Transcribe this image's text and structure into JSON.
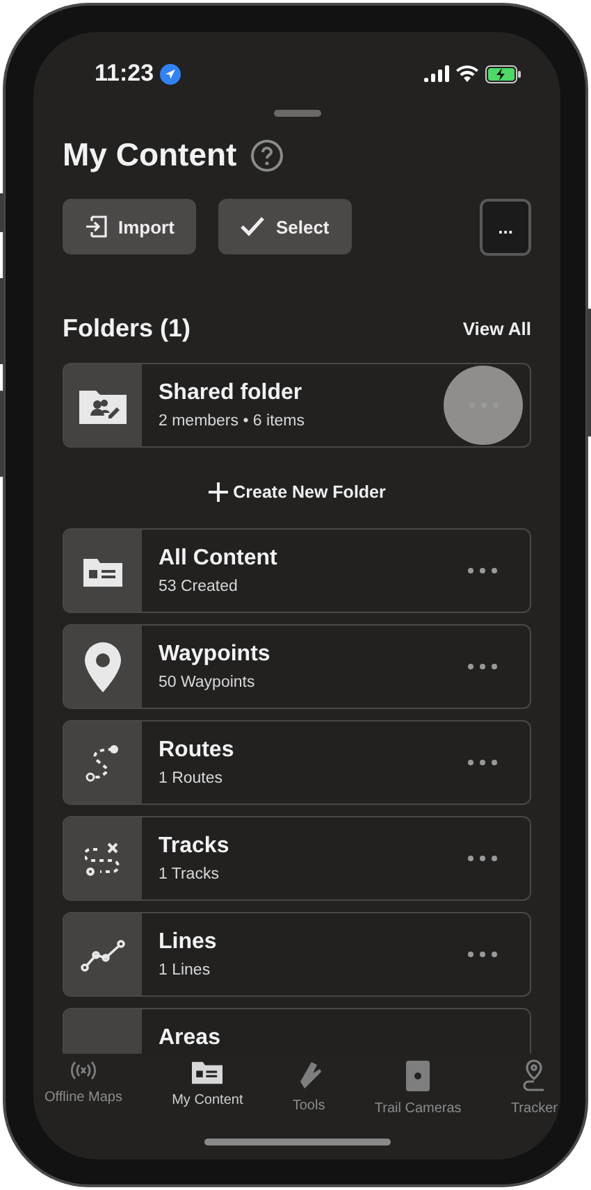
{
  "status_bar": {
    "time": "11:23",
    "location_active": true
  },
  "title": "My Content",
  "actions": [
    {
      "kind": "import",
      "label": "Import"
    },
    {
      "kind": "select",
      "label": "Select"
    },
    {
      "kind": "more",
      "label": "..."
    }
  ],
  "folders": {
    "heading": "Folders (1)",
    "view_all": "View All",
    "items": [
      {
        "kind": "shared",
        "title": "Shared folder",
        "subtitle": "2 members • 6 items",
        "pressed": true
      }
    ],
    "create": "Create New Folder"
  },
  "content": [
    {
      "kind": "all",
      "title": "All Content",
      "subtitle": "53 Created"
    },
    {
      "kind": "waypoint",
      "title": "Waypoints",
      "subtitle": "50 Waypoints"
    },
    {
      "kind": "route",
      "title": "Routes",
      "subtitle": "1 Routes"
    },
    {
      "kind": "track",
      "title": "Tracks",
      "subtitle": "1 Tracks"
    },
    {
      "kind": "line",
      "title": "Lines",
      "subtitle": "1 Lines"
    },
    {
      "title": "Areas"
    }
  ],
  "tabs": [
    {
      "kind": "offline",
      "label": "Offline Maps",
      "selected": false
    },
    {
      "kind": "content",
      "label": "My Content",
      "selected": true
    },
    {
      "kind": "tools",
      "label": "Tools",
      "selected": false
    },
    {
      "kind": "camera",
      "label": "Trail Cameras",
      "selected": false
    },
    {
      "kind": "tracker",
      "label": "Tracker",
      "selected": false
    }
  ]
}
